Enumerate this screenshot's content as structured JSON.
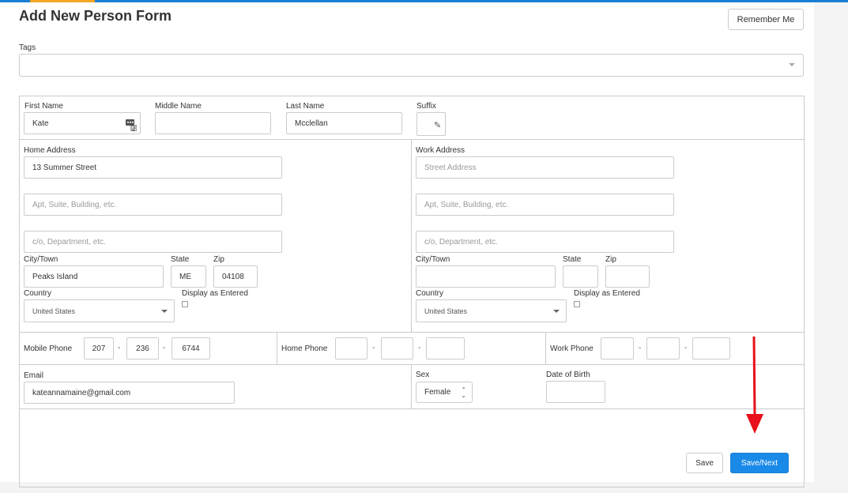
{
  "page": {
    "title": "Add New Person Form",
    "remember_label": "Remember Me"
  },
  "tags": {
    "label": "Tags"
  },
  "name": {
    "first_label": "First Name",
    "first_value": "Kate",
    "middle_label": "Middle Name",
    "middle_value": "",
    "last_label": "Last Name",
    "last_value": "Mcclellan",
    "suffix_label": "Suffix"
  },
  "home": {
    "label": "Home Address",
    "street": "13 Summer Street",
    "apt_placeholder": "Apt, Suite, Building, etc.",
    "co_placeholder": "c/o, Department, etc.",
    "city_label": "City/Town",
    "city": "Peaks Island",
    "state_label": "State",
    "state": "ME",
    "zip_label": "Zip",
    "zip": "04108",
    "country_label": "Country",
    "country": "United States",
    "display_label": "Display as Entered"
  },
  "work": {
    "label": "Work Address",
    "street_placeholder": "Street Address",
    "apt_placeholder": "Apt, Suite, Building, etc.",
    "co_placeholder": "c/o, Department, etc.",
    "city_label": "City/Town",
    "city": "",
    "state_label": "State",
    "state": "",
    "zip_label": "Zip",
    "zip": "",
    "country_label": "Country",
    "country": "United States",
    "display_label": "Display as Entered"
  },
  "phones": {
    "mobile_label": "Mobile Phone",
    "mobile": [
      "207",
      "236",
      "6744"
    ],
    "home_label": "Home Phone",
    "home": [
      "",
      "",
      ""
    ],
    "work_label": "Work Phone",
    "work": [
      "",
      "",
      ""
    ],
    "separator": "-"
  },
  "contact": {
    "email_label": "Email",
    "email": "kateannamaine@gmail.com",
    "sex_label": "Sex",
    "sex": "Female",
    "dob_label": "Date of Birth",
    "dob": ""
  },
  "actions": {
    "save_label": "Save",
    "savenext_label": "Save/Next"
  },
  "colors": {
    "primary": "#1a8ae8",
    "accent": "#f5a623",
    "arrow": "#e8101a"
  }
}
